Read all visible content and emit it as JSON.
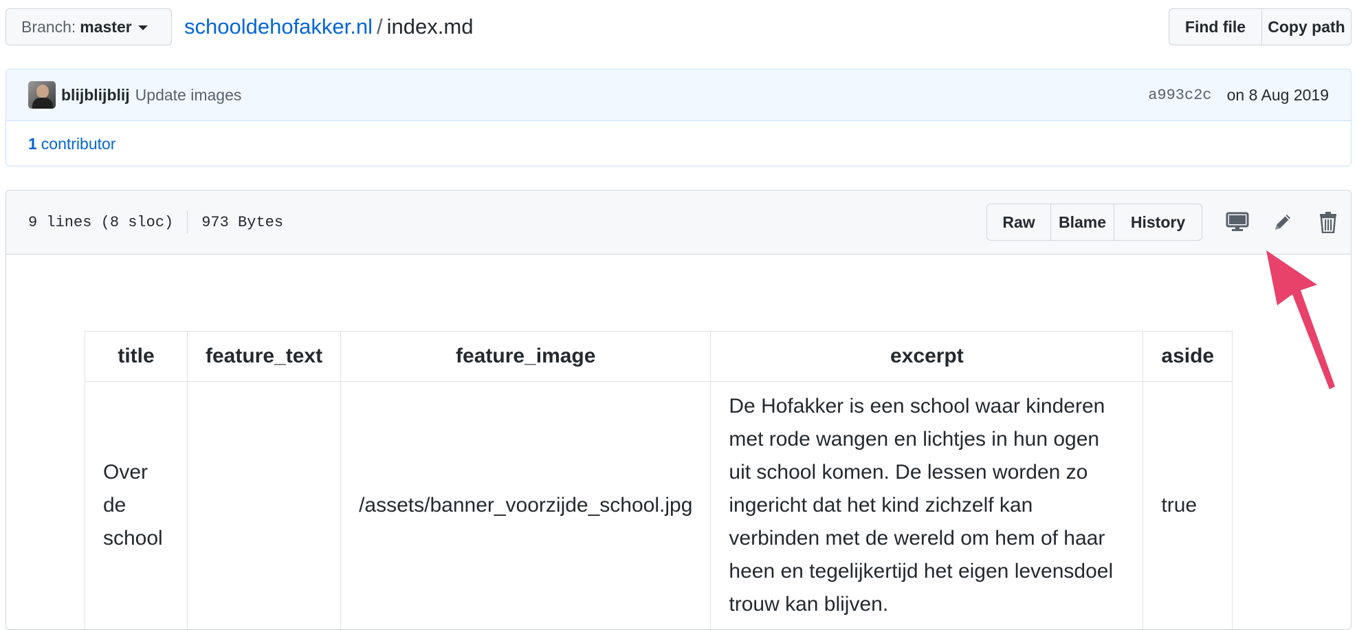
{
  "topbar": {
    "branch_prefix": "Branch:",
    "branch_name": "master",
    "repo_name": "schooldehofakker.nl",
    "separator": "/",
    "file_name": "index.md",
    "find_file": "Find file",
    "copy_path": "Copy path"
  },
  "commit": {
    "author": "blijblijblij",
    "message": "Update images",
    "sha": "a993c2c",
    "date": "on 8 Aug 2019",
    "contributor_count": "1",
    "contributor_label": "contributor"
  },
  "file": {
    "lines": "9 lines (8 sloc)",
    "size": "973 Bytes",
    "raw": "Raw",
    "blame": "Blame",
    "history": "History"
  },
  "table": {
    "headers": [
      "title",
      "feature_text",
      "feature_image",
      "excerpt",
      "aside"
    ],
    "row": {
      "title": "Over de school",
      "feature_text": "",
      "feature_image": "/assets/banner_voorzijde_school.jpg",
      "excerpt": "De Hofakker is een school waar kinderen met rode wangen en lichtjes in hun ogen uit school komen. De lessen worden zo ingericht dat het kind zichzelf kan verbinden met de wereld om hem of haar heen en tegelijkertijd het eigen levensdoel trouw kan blijven.",
      "aside": "true"
    }
  },
  "icons": {
    "desktop": "desktop-icon",
    "pencil": "pencil-icon",
    "trash": "trash-icon",
    "annotation": "annotation-arrow"
  },
  "colors": {
    "link": "#0366d6",
    "annotation_arrow": "#e8416a",
    "commit_bg": "#f1f8ff",
    "header_bg": "#f6f8fa"
  }
}
